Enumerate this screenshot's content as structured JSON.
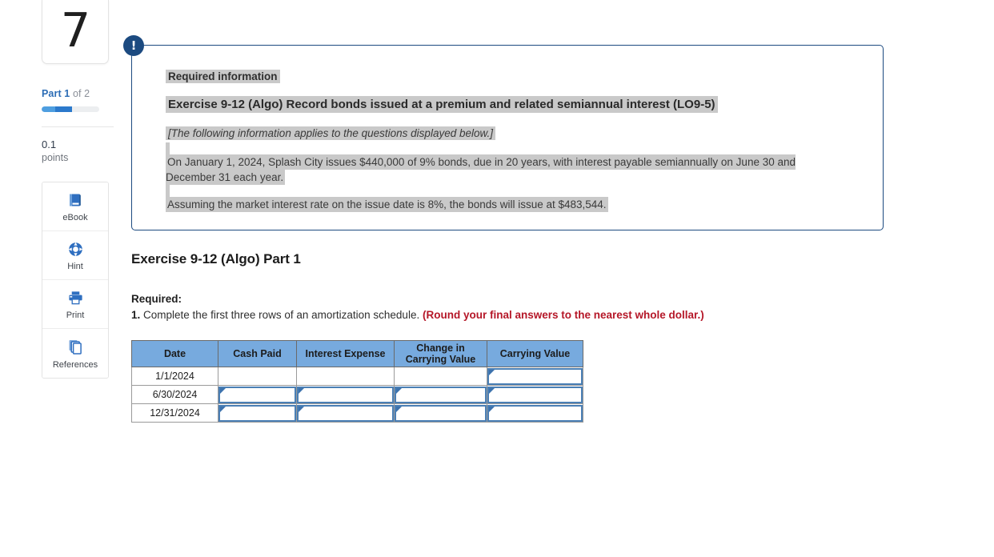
{
  "left_rail": {
    "question_number": "7",
    "part_prefix": "Part",
    "part_current": "1",
    "part_suffix": "of 2",
    "points_value": "0.1",
    "points_word": "points",
    "tools": [
      {
        "label": "eBook",
        "icon": "book-icon"
      },
      {
        "label": "Hint",
        "icon": "life-ring-icon"
      },
      {
        "label": "Print",
        "icon": "printer-icon"
      },
      {
        "label": "References",
        "icon": "stacked-pages-icon"
      }
    ]
  },
  "required_info": {
    "badge": "!",
    "label": "Required information",
    "exercise_title": "Exercise 9-12 (Algo) Record bonds issued at a premium and related semiannual interest (LO9-5)",
    "applies_note": "[The following information applies to the questions displayed below.]",
    "paragraph_1": "On January 1, 2024, Splash City issues $440,000 of 9% bonds, due in 20 years, with interest payable semiannually on June 30 and December 31 each year.",
    "paragraph_2": "Assuming the market interest rate on the issue date is 8%, the bonds will issue at $483,544."
  },
  "part_section": {
    "heading": "Exercise 9-12 (Algo) Part 1",
    "required_label": "Required:",
    "item_number": "1.",
    "item_text": "Complete the first three rows of an amortization schedule.",
    "round_note": "(Round your final answers to the nearest whole dollar.)"
  },
  "amortization_table": {
    "headers": [
      "Date",
      "Cash Paid",
      "Interest Expense",
      "Change in Carrying Value",
      "Carrying Value"
    ],
    "header_change_line1": "Change in",
    "header_change_line2": "Carrying Value",
    "rows": [
      {
        "date": "1/1/2024",
        "cash_paid": {
          "type": "blank",
          "value": ""
        },
        "interest_expense": {
          "type": "blank",
          "value": ""
        },
        "change_in_carrying_value": {
          "type": "blank",
          "value": ""
        },
        "carrying_value": {
          "type": "input",
          "value": ""
        }
      },
      {
        "date": "6/30/2024",
        "cash_paid": {
          "type": "input",
          "value": ""
        },
        "interest_expense": {
          "type": "input",
          "value": ""
        },
        "change_in_carrying_value": {
          "type": "input",
          "value": ""
        },
        "carrying_value": {
          "type": "input",
          "value": ""
        }
      },
      {
        "date": "12/31/2024",
        "cash_paid": {
          "type": "input",
          "value": ""
        },
        "interest_expense": {
          "type": "input",
          "value": ""
        },
        "change_in_carrying_value": {
          "type": "input",
          "value": ""
        },
        "carrying_value": {
          "type": "input",
          "value": ""
        }
      }
    ]
  },
  "colors": {
    "accent_navy": "#1c4a80",
    "table_header_blue": "#77aade",
    "input_border_blue": "#4a7fb5",
    "highlight_gray": "#c9c9c9",
    "warning_red": "#b51728",
    "progress_blue": "#2b79cc"
  }
}
